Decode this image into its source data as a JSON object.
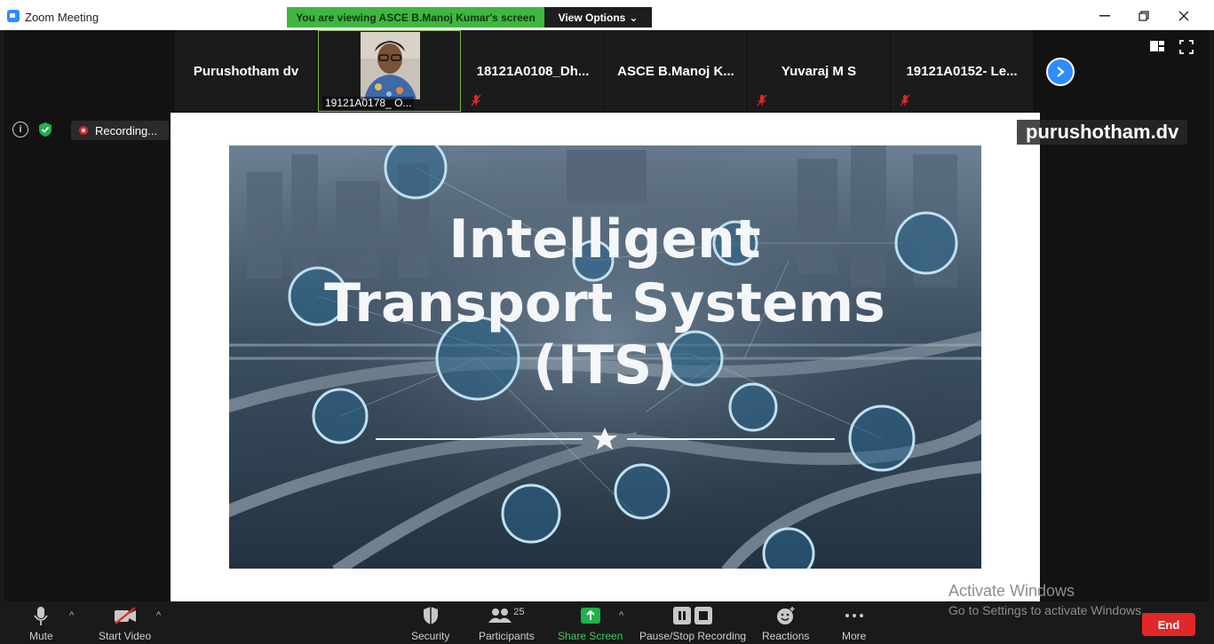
{
  "window": {
    "title": "Zoom Meeting",
    "viewing_banner": "You are viewing ASCE B.Manoj Kumar's screen",
    "view_options": "View Options"
  },
  "participants": [
    {
      "name": "Purushotham dv"
    },
    {
      "name": "19121A0178_ O...",
      "video": true
    },
    {
      "name": "18121A0108_Dh..."
    },
    {
      "name": "ASCE B.Manoj K..."
    },
    {
      "name": "Yuvaraj M S"
    },
    {
      "name": "19121A0152- Le..."
    }
  ],
  "stage": {
    "recording_label": "Recording...",
    "presenter_name": "purushotham.dv"
  },
  "slide": {
    "title_line1": "Intelligent",
    "title_line2": "Transport Systems",
    "title_line3": "(ITS)"
  },
  "toolbar": {
    "mute": "Mute",
    "start_video": "Start Video",
    "security": "Security",
    "participants": "Participants",
    "participant_count": "25",
    "share_screen": "Share Screen",
    "pause_stop_recording": "Pause/Stop Recording",
    "reactions": "Reactions",
    "more": "More",
    "end": "End"
  },
  "watermark": {
    "title": "Activate Windows",
    "subtitle": "Go to Settings to activate Windows."
  },
  "colors": {
    "accent_blue": "#2d8cff",
    "share_green": "#3fb73f",
    "end_red": "#e02828"
  }
}
